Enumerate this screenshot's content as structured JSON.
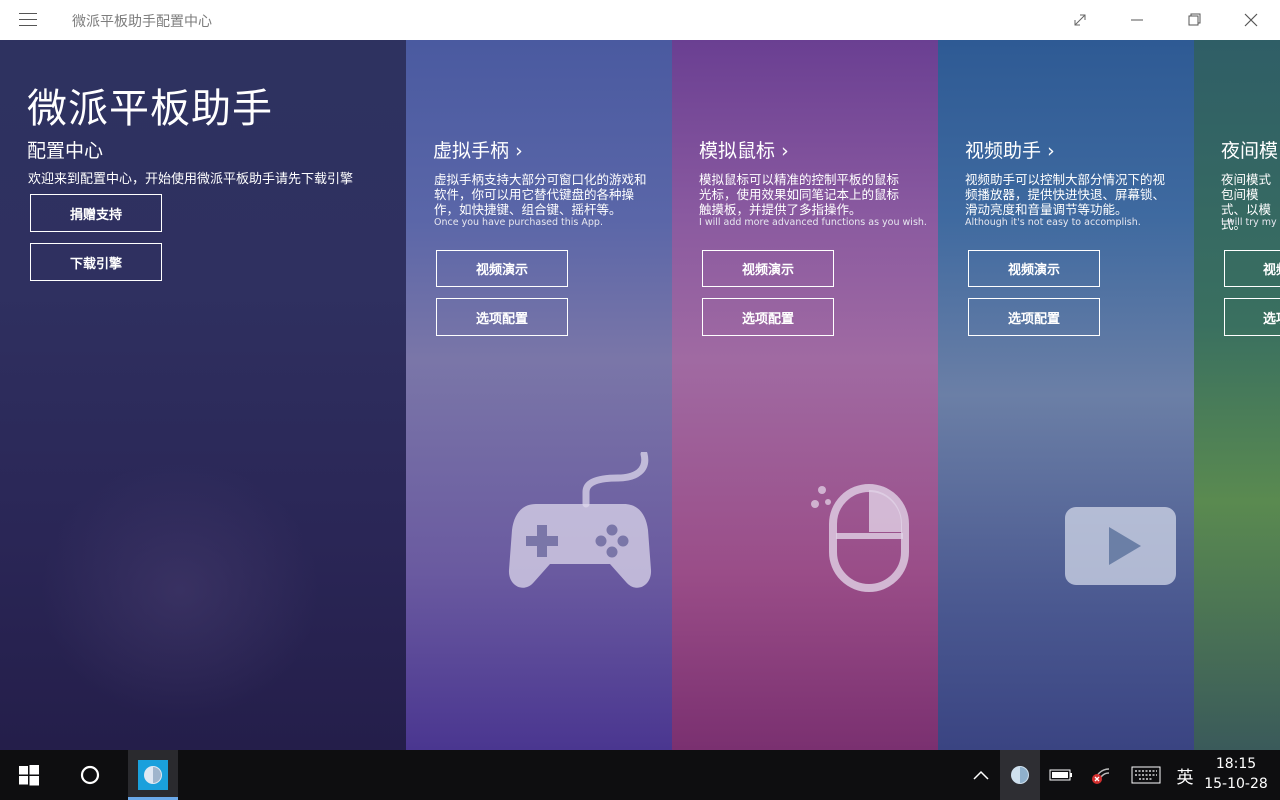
{
  "window": {
    "title": "微派平板助手配置中心",
    "icons": [
      "hamburger-menu-icon",
      "fullscreen-icon",
      "minimize-icon",
      "restore-icon",
      "close-icon"
    ]
  },
  "home": {
    "app_title": "微派平板助手",
    "section_title": "配置中心",
    "welcome": "欢迎来到配置中心，开始使用微派平板助手请先下载引擎",
    "donate_label": "捐赠支持",
    "download_label": "下载引擎"
  },
  "gamepad": {
    "title": "虚拟手柄",
    "chevron": "›",
    "desc": "虚拟手柄支持大部分可窗口化的游戏和软件，你可以用它替代键盘的各种操作，如快捷键、组合键、摇杆等。",
    "en": "Once you have purchased this App.",
    "demo_label": "视频演示",
    "config_label": "选项配置",
    "icon": "gamepad-icon"
  },
  "mouse": {
    "title": "模拟鼠标",
    "chevron": "›",
    "desc": "模拟鼠标可以精准的控制平板的鼠标光标，使用效果如同笔记本上的鼠标触摸板，并提供了多指操作。",
    "en": "I will add more advanced functions as you wish.",
    "demo_label": "视频演示",
    "config_label": "选项配置",
    "icon": "mouse-icon"
  },
  "video": {
    "title": "视频助手",
    "chevron": "›",
    "desc": "视频助手可以控制大部分情况下的视频播放器，提供快进快退、屏幕锁、滑动亮度和音量调节等功能。",
    "en": "Although it's not easy to accomplish.",
    "demo_label": "视频演示",
    "config_label": "选项配置",
    "icon": "play-icon"
  },
  "night": {
    "title": "夜间模",
    "desc": "夜间模式包间模式、以模式。",
    "en": "I will try my b",
    "demo_label": "视频",
    "config_label": "选项"
  },
  "taskbar": {
    "ime": "英",
    "time": "18:15",
    "date": "15-10-28",
    "icons": [
      "windows-start-icon",
      "cortana-search-icon",
      "app-taskbar-icon",
      "show-hidden-icons-chevron",
      "app-tray-icon",
      "battery-icon",
      "network-disconnected-icon",
      "keyboard-icon"
    ]
  },
  "colors": {
    "titlebar_bg": "#ffffff",
    "home_panel": "#2e3260",
    "gamepad_panel": "#5a66a8",
    "mouse_panel": "#8a5aa0",
    "video_panel": "#3f6aa0",
    "night_panel": "#3a7060",
    "taskbar_bg": "#0e0e10",
    "accent": "#1aa0dc"
  }
}
